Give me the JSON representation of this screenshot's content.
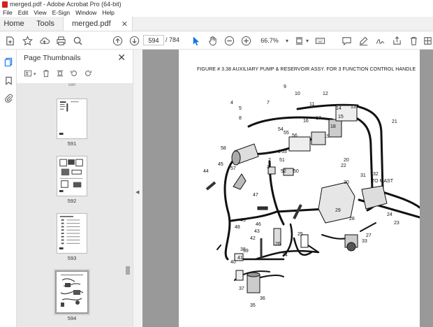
{
  "window": {
    "title": "merged.pdf - Adobe Acrobat Pro (64-bit)"
  },
  "menu": [
    "File",
    "Edit",
    "View",
    "E-Sign",
    "Window",
    "Help"
  ],
  "tabs": {
    "home": "Home",
    "tools": "Tools",
    "document": "merged.pdf"
  },
  "toolbar": {
    "current_page": "594",
    "total_pages": "/  784",
    "zoom": "66.7%"
  },
  "panel": {
    "title": "Page Thumbnails",
    "thumbnails": [
      {
        "label": "591"
      },
      {
        "label": "592"
      },
      {
        "label": "593"
      },
      {
        "label": "594"
      }
    ],
    "top_partial_label": "590"
  },
  "document": {
    "figure_title": "FIGURE # 3.38  AUXILIARY PUMP & RESERVOIR ASSY. FOR 3 FUNCTION CONTROL HANDLE",
    "callouts": [
      "9",
      "10",
      "12",
      "4",
      "5",
      "7",
      "8",
      "11",
      "13",
      "14",
      "15",
      "16",
      "17",
      "18",
      "19",
      "20",
      "21",
      "22",
      "1",
      "2",
      "3",
      "50",
      "51",
      "52",
      "53",
      "54",
      "55",
      "56",
      "57",
      "58",
      "44",
      "45",
      "46",
      "47",
      "48",
      "49",
      "25",
      "26",
      "27",
      "28",
      "29",
      "30",
      "31",
      "32",
      "23",
      "24",
      "33",
      "34",
      "35",
      "36",
      "37",
      "38",
      "39",
      "40",
      "41",
      "42",
      "43"
    ],
    "mast_label": "TO  MAST"
  },
  "colors": {
    "accent": "#1473e6",
    "brand": "#d4201b"
  }
}
